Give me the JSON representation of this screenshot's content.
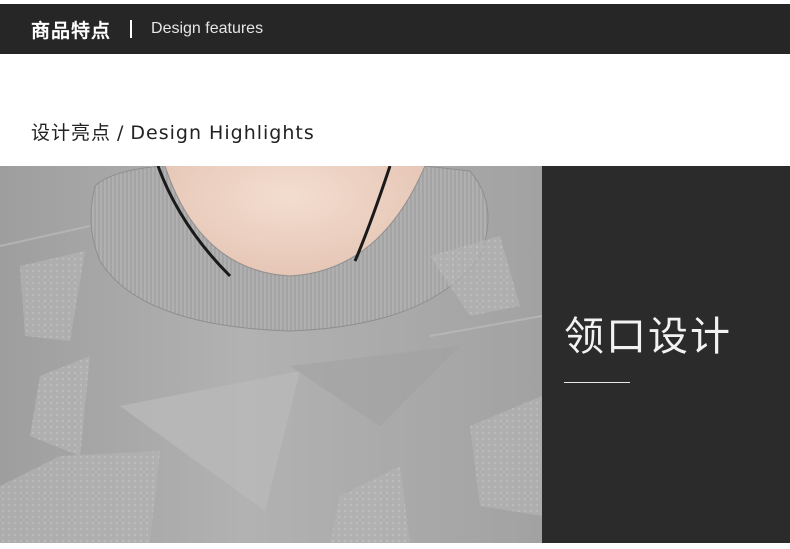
{
  "header": {
    "title_cn": "商品特点",
    "title_en": "Design features"
  },
  "subtitle": {
    "cn": "设计亮点",
    "separator": "/",
    "en": "Design Highlights"
  },
  "feature_panel": {
    "title": "领口设计"
  },
  "colors": {
    "header_bg": "#262626",
    "panel_bg": "#2b2b2b",
    "sweater_gray": "#a9a9a9"
  }
}
